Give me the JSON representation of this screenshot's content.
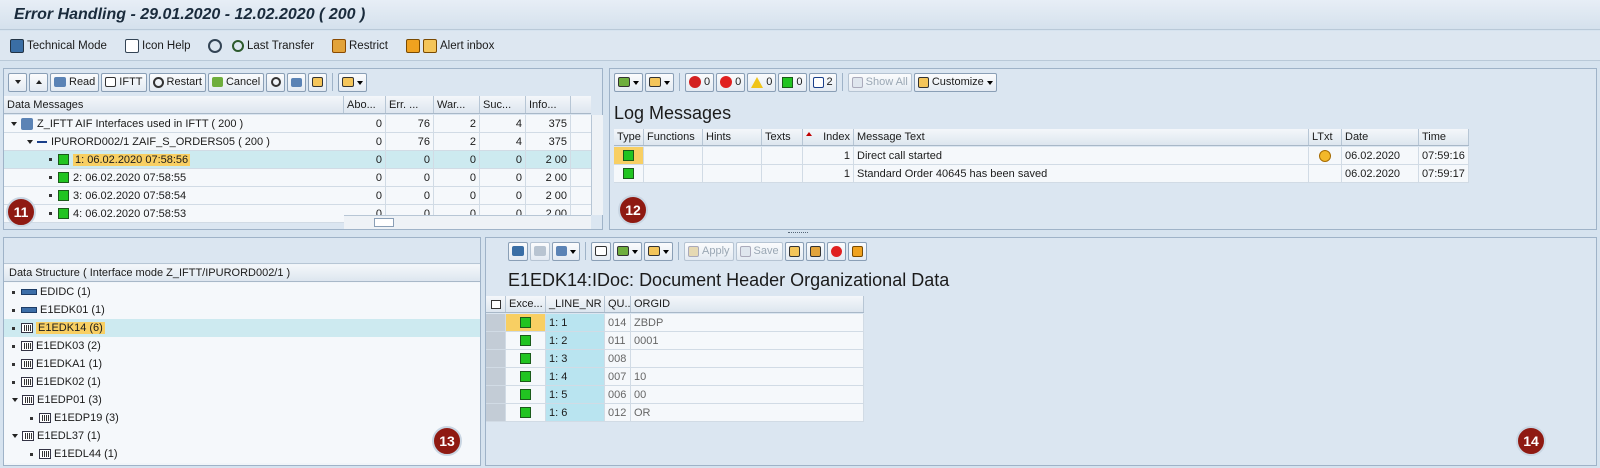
{
  "window": {
    "title": "Error Handling - 29.01.2020 - 12.02.2020 ( 200 )"
  },
  "toolbar": {
    "technical_mode": "Technical Mode",
    "icon_help": "Icon Help",
    "last_transfer": "Last Transfer",
    "restrict": "Restrict",
    "alert_inbox": "Alert inbox"
  },
  "messages_panel": {
    "buttons": {
      "read": "Read",
      "ifft": "IFTT",
      "restart": "Restart",
      "cancel": "Cancel"
    },
    "columns": [
      "Data Messages",
      "Abo...",
      "Err. ...",
      "War...",
      "Suc...",
      "Info..."
    ],
    "rows": [
      {
        "label": "Z_IFTT AIF Interfaces used in IFTT ( 200 )",
        "abo": "0",
        "err": "76",
        "war": "2",
        "suc": "4",
        "info": "375"
      },
      {
        "label": "IPURORD002/1 ZAIF_S_ORDERS05 ( 200 )",
        "abo": "0",
        "err": "76",
        "war": "2",
        "suc": "4",
        "info": "375"
      },
      {
        "label": "1: 06.02.2020 07:58:56",
        "abo": "0",
        "err": "0",
        "war": "0",
        "suc": "0",
        "info": "2 00"
      },
      {
        "label": "2: 06.02.2020 07:58:55",
        "abo": "0",
        "err": "0",
        "war": "0",
        "suc": "0",
        "info": "2 00"
      },
      {
        "label": "3: 06.02.2020 07:58:54",
        "abo": "0",
        "err": "0",
        "war": "0",
        "suc": "0",
        "info": "2 00"
      },
      {
        "label": "4: 06.02.2020 07:58:53",
        "abo": "0",
        "err": "0",
        "war": "0",
        "suc": "0",
        "info": "2 00"
      }
    ],
    "marker": "11"
  },
  "log_panel": {
    "counts": {
      "stop": "0",
      "error": "0",
      "warning": "0",
      "success": "0",
      "info": "2"
    },
    "buttons": {
      "show_all": "Show All",
      "customize": "Customize"
    },
    "title": "Log Messages",
    "columns": [
      "Type",
      "Functions",
      "Hints",
      "Texts",
      "Index",
      "Message Text",
      "LTxt",
      "Date",
      "Time"
    ],
    "rows": [
      {
        "index": "1",
        "text": "Direct call started",
        "date": "06.02.2020",
        "time": "07:59:16"
      },
      {
        "index": "1",
        "text": "Standard Order 40645 has been saved",
        "date": "06.02.2020",
        "time": "07:59:17"
      }
    ],
    "marker": "12"
  },
  "structure_panel": {
    "title": "Data Structure ( Interface mode Z_IFTT/IPURORD002/1 )",
    "items": [
      "EDIDC (1)",
      "E1EDK01 (1)",
      "E1EDK14 (6)",
      "E1EDK03 (2)",
      "E1EDKA1 (1)",
      "E1EDK02 (1)",
      "E1EDP01 (3)",
      "E1EDP19 (3)",
      "E1EDL37 (1)",
      "E1EDL44 (1)"
    ],
    "marker": "13"
  },
  "detail_panel": {
    "buttons": {
      "apply": "Apply",
      "save": "Save"
    },
    "title": "E1EDK14:IDoc: Document Header Organizational Data",
    "columns": [
      "Exce...",
      "_LINE_NR",
      "QU...",
      "ORGID"
    ],
    "rows": [
      {
        "line": "1: 1",
        "qu": "014",
        "orgid": "ZBDP"
      },
      {
        "line": "1: 2",
        "qu": "011",
        "orgid": "0001"
      },
      {
        "line": "1: 3",
        "qu": "008",
        "orgid": ""
      },
      {
        "line": "1: 4",
        "qu": "007",
        "orgid": "10"
      },
      {
        "line": "1: 5",
        "qu": "006",
        "orgid": "00"
      },
      {
        "line": "1: 6",
        "qu": "012",
        "orgid": "OR"
      }
    ],
    "marker": "14"
  }
}
